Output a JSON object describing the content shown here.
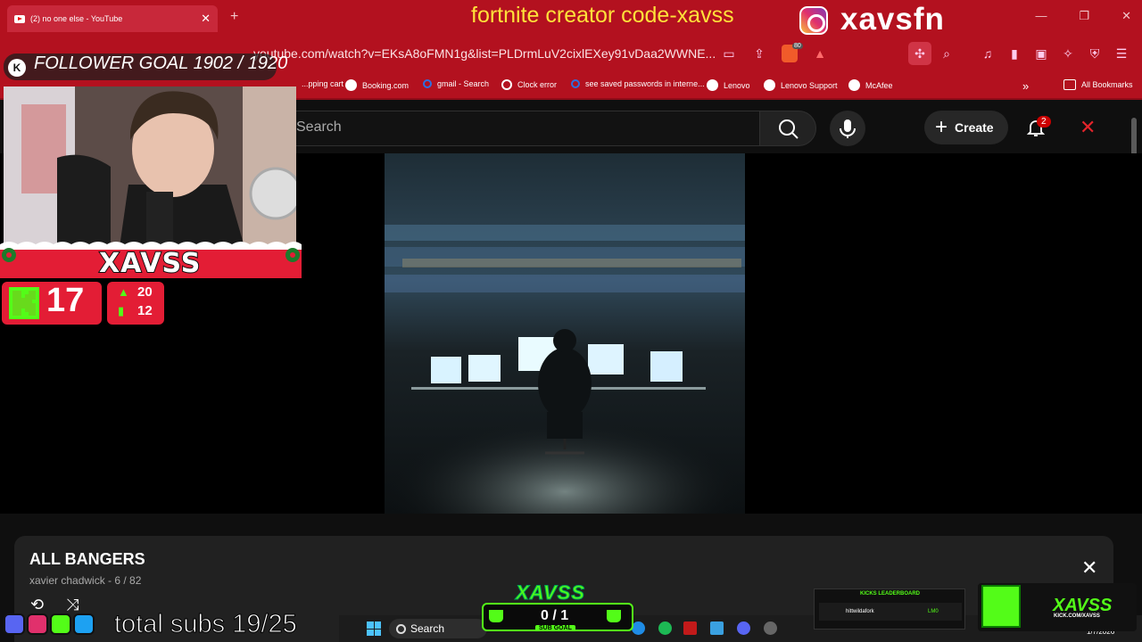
{
  "browser": {
    "tab_title": "(2) no one else - YouTube",
    "url": "youtube.com/watch?v=EKsA8oFMN1g&list=PLDrmLuV2cixlEXey91vDaa2WWNE...",
    "brave_badge": "80",
    "bookmarks": [
      {
        "label": "...pping cart"
      },
      {
        "label": "Booking.com"
      },
      {
        "label": "gmail - Search"
      },
      {
        "label": "Clock error"
      },
      {
        "label": "see saved passwords in interne..."
      },
      {
        "label": "Lenovo"
      },
      {
        "label": "Lenovo Support"
      },
      {
        "label": "McAfee"
      }
    ],
    "all_bookmarks": "All Bookmarks",
    "more_glyph": "»"
  },
  "overlay": {
    "banner_text": "fortnite creator code-xavss",
    "instagram_handle": "xavsfn",
    "follower_goal": "FOLLOWER GOAL 1902 / 1920",
    "streamer_name": "XAVSS",
    "kick_count": "17",
    "stat_up": "20",
    "stat_bars": "12",
    "total_subs": "total subs 19/25",
    "sub_goal_brand": "XAVSS",
    "sub_goal_count": "0 / 1",
    "sub_goal_label": "SUB GOAL",
    "leaderboard_title": "KICKS LEADERBOARD",
    "leaderboard_user": "hittwildafork",
    "leaderboard_value": "LM0",
    "kick_brand_name": "XAVSS",
    "kick_brand_url": "KICK.COM/XAVSS"
  },
  "youtube": {
    "search_placeholder": "Search",
    "create_label": "Create",
    "notification_count": "2"
  },
  "playlist": {
    "title": "ALL BANGERS",
    "subtitle": "xavier chadwick - 6 / 82"
  },
  "taskbar": {
    "search_label": "Search",
    "date": "1/7/2026"
  },
  "colors": {
    "browser_red": "#b3111f",
    "kick_green": "#53fc18",
    "banner_yellow": "#ffe13a"
  }
}
